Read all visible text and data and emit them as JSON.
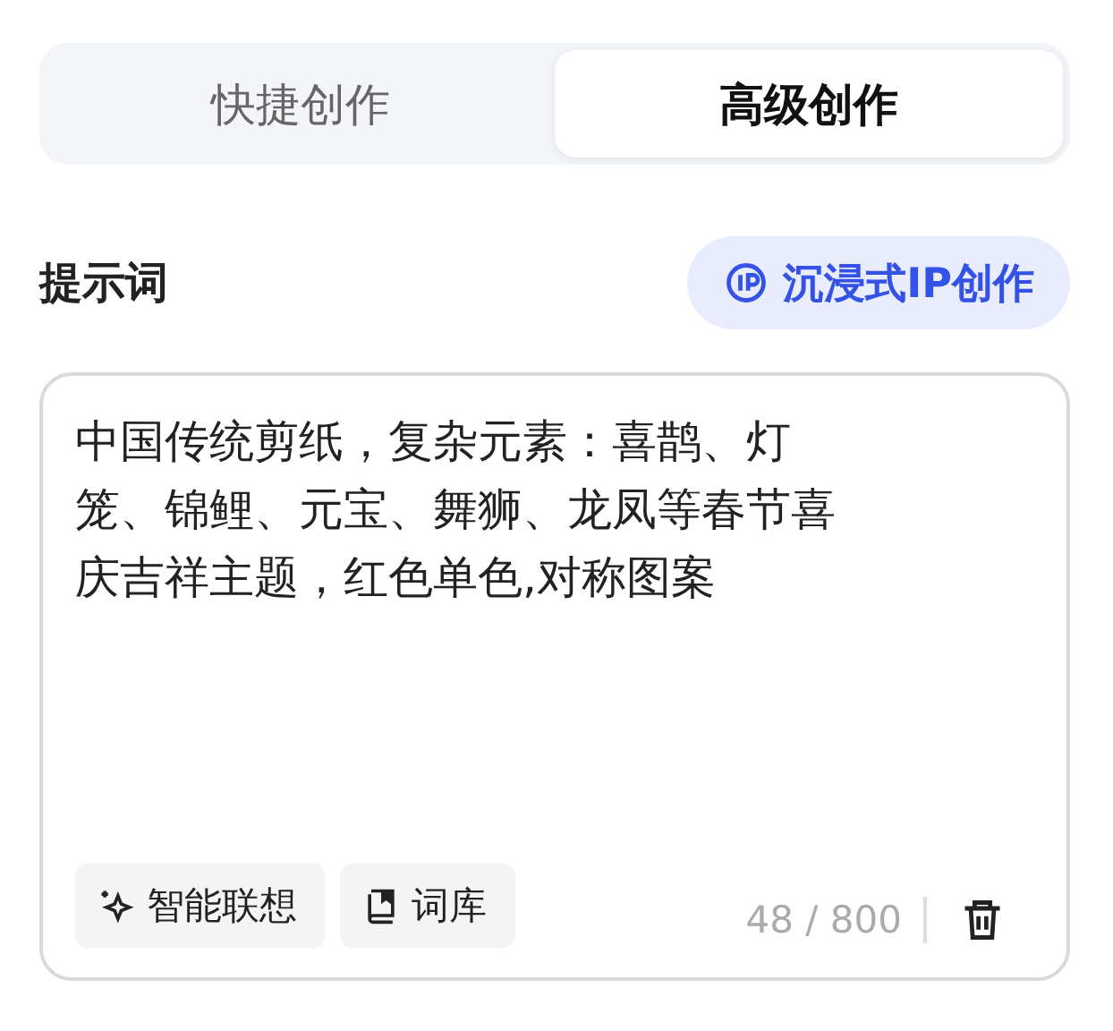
{
  "tabs": [
    {
      "label": "快捷创作",
      "selected": false
    },
    {
      "label": "高级创作",
      "selected": true
    }
  ],
  "prompt_section": {
    "label": "提示词",
    "ip_button": "沉浸式IP创作"
  },
  "prompt": {
    "value": "中国传统剪纸，复杂元素：喜鹊、灯笼、锦鲤、元宝、舞狮、龙凤等春节喜庆吉祥主题，红色单色,对称图案",
    "tools": [
      "智能联想",
      "词库"
    ],
    "counter": "48 / 800"
  }
}
